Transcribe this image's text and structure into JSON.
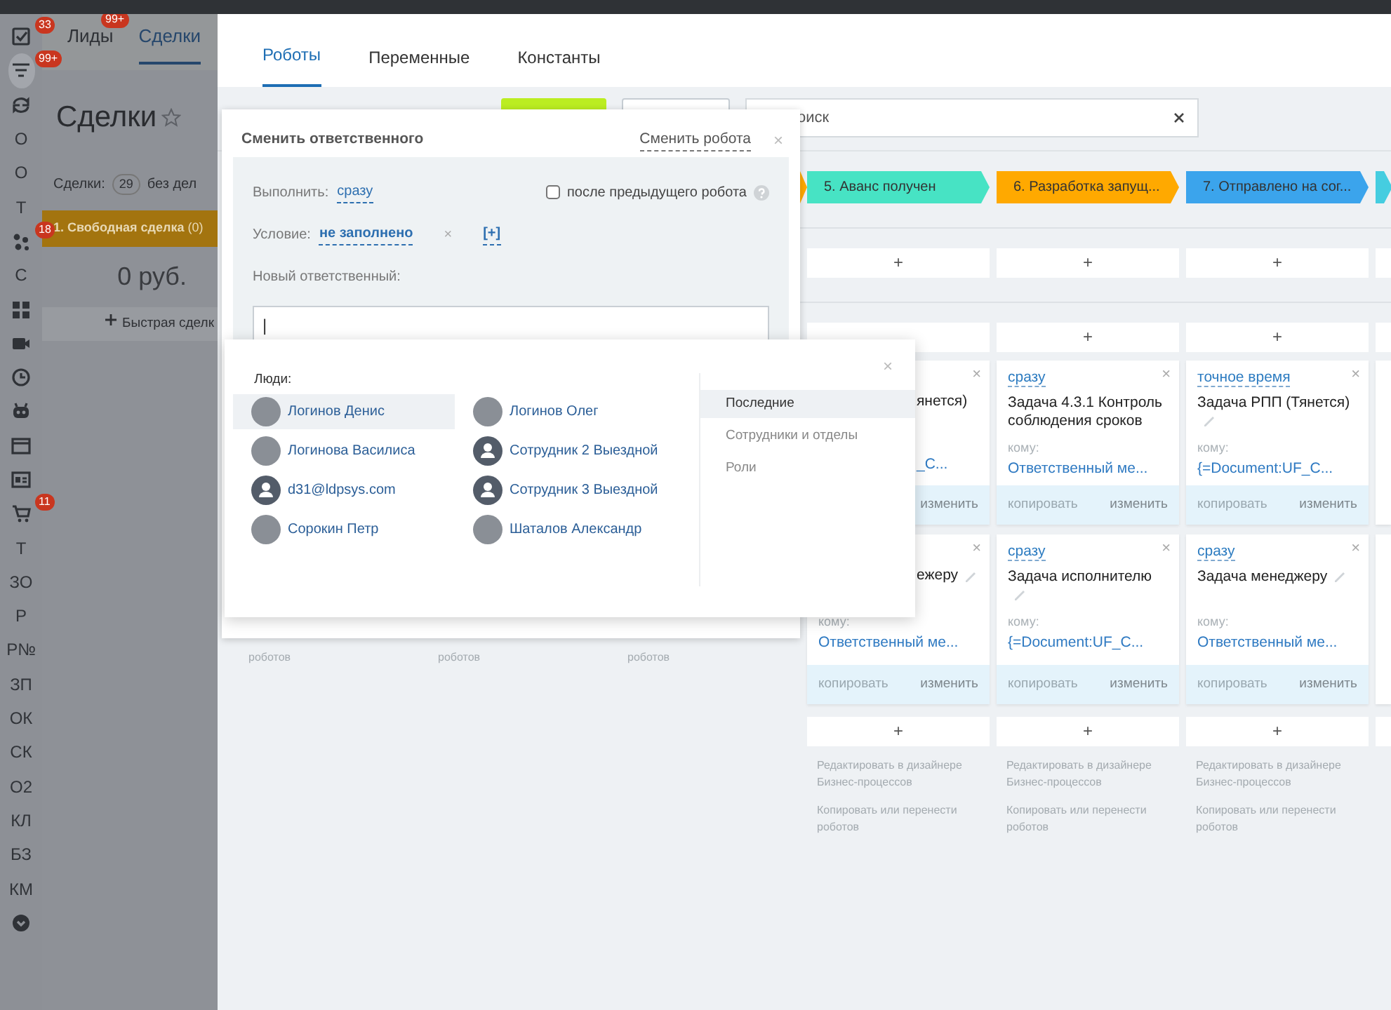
{
  "sidebar": {
    "items": [
      {
        "kind": "icon",
        "badge": "33",
        "selected": false
      },
      {
        "kind": "icon",
        "badge": "99+",
        "selected": true
      },
      {
        "kind": "icon",
        "selected": false
      },
      {
        "kind": "text",
        "label": "О",
        "selected": false
      },
      {
        "kind": "text",
        "label": "О",
        "selected": false
      },
      {
        "kind": "text",
        "label": "Т",
        "selected": false
      },
      {
        "kind": "icon",
        "badge": "18",
        "selected": false
      },
      {
        "kind": "text",
        "label": "С",
        "selected": false
      },
      {
        "kind": "icon",
        "selected": false
      },
      {
        "kind": "icon",
        "selected": false
      },
      {
        "kind": "icon",
        "selected": false
      },
      {
        "kind": "icon",
        "selected": false
      },
      {
        "kind": "icon",
        "selected": false
      },
      {
        "kind": "icon",
        "selected": false
      },
      {
        "kind": "icon",
        "badge": "11",
        "selected": false
      },
      {
        "kind": "text",
        "label": "Т",
        "selected": false
      },
      {
        "kind": "text",
        "label": "ЗО",
        "selected": false
      },
      {
        "kind": "text",
        "label": "Р",
        "selected": false
      },
      {
        "kind": "text",
        "label": "Р№",
        "selected": false
      },
      {
        "kind": "text",
        "label": "ЗП",
        "selected": false
      },
      {
        "kind": "text",
        "label": "ОК",
        "selected": false
      },
      {
        "kind": "text",
        "label": "СК",
        "selected": false
      },
      {
        "kind": "text",
        "label": "О2",
        "selected": false
      },
      {
        "kind": "text",
        "label": "КЛ",
        "selected": false
      },
      {
        "kind": "text",
        "label": "БЗ",
        "selected": false
      },
      {
        "kind": "text",
        "label": "КМ",
        "selected": false
      },
      {
        "kind": "icon",
        "selected": false
      }
    ]
  },
  "crm": {
    "tabs": [
      {
        "label": "Лиды",
        "badge": "99+",
        "selected": false
      },
      {
        "label": "Сделки",
        "selected": true
      }
    ],
    "title": "Сделки",
    "counter_label": "Сделки:",
    "counter": "29",
    "filter": "без дел",
    "stage": {
      "label": "1. Свободная сделка",
      "count": "(0)"
    },
    "sum": "0 руб.",
    "quick_add": "Быстрая сделк"
  },
  "robots": {
    "tabs": [
      {
        "label": "Роботы",
        "selected": true
      },
      {
        "label": "Переменные",
        "selected": false
      },
      {
        "label": "Константы",
        "selected": false
      }
    ],
    "search": {
      "placeholder": "оиск"
    },
    "columns": [
      {
        "kind": "covered",
        "footer_tail": "роботов"
      },
      {
        "kind": "covered",
        "footer_tail": "роботов"
      },
      {
        "kind": "covered",
        "stage": {
          "color": "#ffa900"
        },
        "footer_tail": "роботов"
      },
      {
        "kind": "partial",
        "stage": {
          "label": "5. Аванс получен",
          "color": "#47e3c4"
        },
        "add_top": "+",
        "add_bottom": "+",
        "cards": [
          {
            "title": "янется)",
            "editable": false,
            "recipient": "_C...",
            "edit": "изменить",
            "close": "×"
          },
          {
            "title": "ежеру",
            "editable": true,
            "to_label": "кому:",
            "recipient": "Ответственный ме...",
            "copy": "копировать",
            "edit": "изменить",
            "close": "×"
          }
        ],
        "footer": [
          "Редактировать в дизайнере Бизнес-процессов",
          "Копировать или перенести роботов"
        ]
      },
      {
        "kind": "full",
        "stage": {
          "label": "6. Разработка запущ...",
          "color": "#ffa900"
        },
        "add_top": "+",
        "add_mid": "+",
        "add_bottom": "+",
        "cards": [
          {
            "timing": "сразу",
            "title": "Задача 4.3.1 Контроль соблюдения сроков",
            "editable": false,
            "to_label": "кому:",
            "recipient": "Ответственный ме...",
            "copy": "копировать",
            "edit": "изменить",
            "close": "×"
          },
          {
            "timing": "сразу",
            "title": "Задача исполнителю",
            "editable": true,
            "to_label": "кому:",
            "recipient": "{=Document:UF_C...",
            "copy": "копировать",
            "edit": "изменить",
            "close": "×"
          }
        ],
        "footer": [
          "Редактировать в дизайнере Бизнес-процессов",
          "Копировать или перенести роботов"
        ]
      },
      {
        "kind": "full",
        "stage": {
          "label": "7. Отправлено на сог...",
          "color": "#3ba4ec"
        },
        "add_top": "+",
        "add_mid": "+",
        "add_bottom": "+",
        "cards": [
          {
            "timing": "точное время",
            "title": "Задача РПП (Тянется)",
            "editable": true,
            "to_label": "кому:",
            "recipient": "{=Document:UF_C...",
            "copy": "копировать",
            "edit": "изменить",
            "close": "×"
          },
          {
            "timing": "сразу",
            "title": "Задача менеджеру",
            "editable": true,
            "to_label": "кому:",
            "recipient": "Ответственный ме...",
            "copy": "копировать",
            "edit": "изменить",
            "close": "×"
          }
        ],
        "footer": [
          "Редактировать в дизайнере Бизнес-процессов",
          "Копировать или перенести роботов"
        ]
      },
      {
        "kind": "cut",
        "stage": {
          "color": "#45cde0"
        }
      }
    ]
  },
  "dialog": {
    "title": "Сменить ответственного",
    "switch_link": "Сменить робота",
    "close": "×",
    "run_label": "Выполнить:",
    "run_value": "сразу",
    "after_previous": {
      "label": "после предыдущего робота",
      "checked": false
    },
    "condition_label": "Условие:",
    "condition_value": "не заполнено",
    "condition_clear": "×",
    "condition_add": "[+]",
    "assignee_label": "Новый ответственный:",
    "assignee_value": "|"
  },
  "selector": {
    "close": "×",
    "people_label": "Люди:",
    "people": [
      {
        "name": "Логинов Денис",
        "kind": "photo",
        "selected": true
      },
      {
        "name": "Логинов Олег",
        "kind": "photo",
        "selected": false
      },
      {
        "name": "Логинова Василиса",
        "kind": "photo",
        "selected": false
      },
      {
        "name": "Сотрудник 2 Выездной",
        "kind": "silhouette",
        "selected": false
      },
      {
        "name": "d31@ldpsys.com",
        "kind": "silhouette",
        "selected": false
      },
      {
        "name": "Сотрудник 3 Выездной",
        "kind": "silhouette",
        "selected": false
      },
      {
        "name": "Сорокин Петр",
        "kind": "photo",
        "selected": false
      },
      {
        "name": "Шаталов Александр",
        "kind": "photo",
        "selected": false
      }
    ],
    "tabs": [
      {
        "label": "Последние",
        "selected": true
      },
      {
        "label": "Сотрудники и отделы",
        "selected": false
      },
      {
        "label": "Роли",
        "selected": false
      }
    ]
  }
}
